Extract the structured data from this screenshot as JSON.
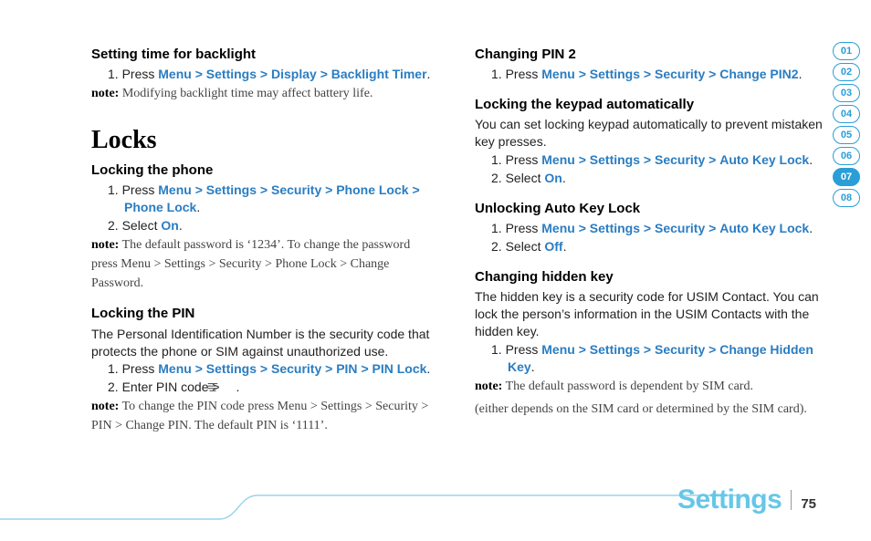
{
  "left": {
    "s1": {
      "heading": "Setting time for backlight",
      "step1_pre": "1. Press ",
      "path": [
        "Menu",
        "Settings",
        "Display",
        "Backlight Timer"
      ],
      "note_label": "note:",
      "note_body": " Modifying backlight time may affect battery life."
    },
    "section_title": "Locks",
    "s2": {
      "heading": "Locking the phone",
      "step1_pre": "1. Press ",
      "path": [
        "Menu",
        "Settings",
        "Security",
        "Phone Lock",
        "Phone Lock"
      ],
      "step2_pre": "2. Select ",
      "step2_on": "On",
      "note_label": "note:",
      "note_body_a": " The default password is ‘1234’. To change the password press ",
      "note_path": [
        "Menu",
        "Settings",
        "Security",
        "Phone Lock",
        "Change Password"
      ],
      "note_body_b": "."
    },
    "s3": {
      "heading": "Locking the PIN",
      "intro": "The Personal Identification Number is the security code that protects the phone or SIM against unauthorized use.",
      "step1_pre": "1. Press ",
      "path": [
        "Menu",
        "Settings",
        "Security",
        "PIN",
        "PIN Lock"
      ],
      "step2": "2. Enter PIN code > ",
      "note_label": "note:",
      "note_body_a": " To change the PIN code press ",
      "note_path": [
        "Menu",
        "Settings",
        "Security",
        "PIN",
        "Change PIN"
      ],
      "note_body_b": ". The default PIN is ‘1111’."
    }
  },
  "right": {
    "s1": {
      "heading": "Changing PIN 2",
      "step1_pre": "1. Press ",
      "path": [
        "Menu",
        "Settings",
        "Security",
        "Change PIN2"
      ]
    },
    "s2": {
      "heading": "Locking the keypad automatically",
      "intro": "You can set locking keypad automatically to prevent mistaken key presses.",
      "step1_pre": "1. Press ",
      "path": [
        "Menu",
        "Settings",
        "Security",
        "Auto Key Lock"
      ],
      "step2_pre": "2. Select ",
      "step2_on": "On"
    },
    "s3": {
      "heading": "Unlocking Auto Key Lock",
      "step1_pre": "1. Press ",
      "path": [
        "Menu",
        "Settings",
        "Security",
        "Auto Key Lock"
      ],
      "step2_pre": "2. Select ",
      "step2_off": "Off"
    },
    "s4": {
      "heading": "Changing hidden key",
      "intro": "The hidden key is a security code for USIM Contact. You can lock the person’s information in the USIM Contacts with the hidden key.",
      "step1_pre": "1. Press ",
      "path": [
        "Menu",
        "Settings",
        "Security",
        "Change Hidden Key"
      ],
      "note_label": "note:",
      "note_body": " The default password is dependent by SIM card.",
      "extra": "(either depends on the SIM card or determined by the SIM card)."
    }
  },
  "tabs": [
    "01",
    "02",
    "03",
    "04",
    "05",
    "06",
    "07",
    "08"
  ],
  "active_tab": "07",
  "footer": {
    "title": "Settings",
    "page": "75"
  }
}
